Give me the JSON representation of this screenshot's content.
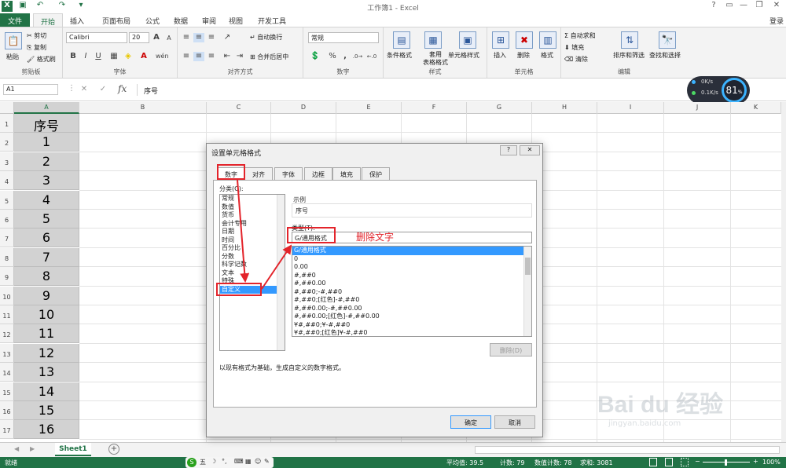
{
  "title_bar": {
    "title": "工作簿1 - Excel",
    "help": "?",
    "minimize": "—",
    "restore": "❐",
    "close": "✕",
    "ribbon_display": "▭"
  },
  "tabs": [
    "文件",
    "开始",
    "插入",
    "页面布局",
    "公式",
    "数据",
    "审阅",
    "视图",
    "开发工具"
  ],
  "login": "登录",
  "ribbon": {
    "clipboard": {
      "paste": "粘贴",
      "cut": "剪切",
      "copy": "复制",
      "format_painter": "格式刷",
      "label": "剪贴板"
    },
    "font": {
      "name": "Calibri",
      "size": "20",
      "bold": "B",
      "italic": "I",
      "underline": "U",
      "grow": "A",
      "shrink": "A",
      "wen": "wén",
      "label": "字体"
    },
    "alignment": {
      "wrap": "自动换行",
      "merge": "合并后居中",
      "label": "对齐方式"
    },
    "number": {
      "format": "常规",
      "percent": "%",
      "comma": ",",
      "label": "数字"
    },
    "styles": {
      "conditional": "条件格式",
      "table": "套用\n表格格式",
      "cell_styles": "单元格样式",
      "label": "样式"
    },
    "cells": {
      "insert": "插入",
      "delete": "删除",
      "format": "格式",
      "label": "单元格"
    },
    "editing": {
      "autosum": "自动求和",
      "fill": "填充",
      "clear": "清除",
      "sort": "排序和筛选",
      "find": "查找和选择",
      "label": "编辑"
    }
  },
  "formula_bar": {
    "name_box": "A1",
    "fx": "fx",
    "value": "序号"
  },
  "net_widget": {
    "up": "0K/s",
    "down": "0.1K/s",
    "percent": "81",
    "unit": "%"
  },
  "columns": [
    "A",
    "B",
    "C",
    "D",
    "E",
    "F",
    "G",
    "H",
    "I",
    "J",
    "K"
  ],
  "rows": [
    "1",
    "2",
    "3",
    "4",
    "5",
    "6",
    "7",
    "8",
    "9",
    "10",
    "11",
    "12",
    "13",
    "14",
    "15",
    "16",
    "17"
  ],
  "col_a_values": [
    "序号",
    "1",
    "2",
    "3",
    "4",
    "5",
    "6",
    "7",
    "8",
    "9",
    "10",
    "11",
    "12",
    "13",
    "14",
    "15",
    "16"
  ],
  "sheet_tabs": {
    "active": "Sheet1",
    "add": "+"
  },
  "status_bar": {
    "mode": "就绪",
    "average": "平均值: 39.5",
    "count": "计数: 79",
    "numeric_count": "数值计数: 78",
    "sum": "求和: 3081",
    "zoom": "100%"
  },
  "dialog": {
    "title": "设置单元格格式",
    "help": "?",
    "close": "✕",
    "tabs": [
      "数字",
      "对齐",
      "字体",
      "边框",
      "填充",
      "保护"
    ],
    "category_label": "分类(C):",
    "categories": [
      "常规",
      "数值",
      "货币",
      "会计专用",
      "日期",
      "时间",
      "百分比",
      "分数",
      "科学记数",
      "文本",
      "特殊",
      "自定义"
    ],
    "sample_label": "示例",
    "sample_value": "序号",
    "type_label": "类型(T):",
    "type_value": "G/通用格式",
    "type_list": [
      "G/通用格式",
      "0",
      "0.00",
      "#,##0",
      "#,##0.00",
      "#,##0;-#,##0",
      "#,##0;[红色]-#,##0",
      "#,##0.00;-#,##0.00",
      "#,##0.00;[红色]-#,##0.00",
      "¥#,##0;¥-#,##0",
      "¥#,##0;[红色]¥-#,##0"
    ],
    "delete_button": "删除(D)",
    "description": "以现有格式为基础，生成自定义的数字格式。",
    "ok": "确定",
    "cancel": "取消"
  },
  "annotation": {
    "text": "删除文字",
    "color": "#e3242b"
  },
  "watermark": {
    "brand": "Bai du 经验",
    "url": "jingyan.baidu.com"
  },
  "colors": {
    "excel_green": "#217346",
    "selection_blue": "#3399ff",
    "annotation_red": "#e3242b"
  }
}
